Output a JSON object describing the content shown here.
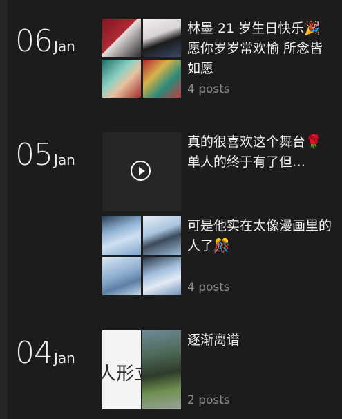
{
  "colors": {
    "background": "#1c1c1c",
    "text": "#f2f2f2",
    "muted": "#8c8c8c"
  },
  "days": [
    {
      "num": "06",
      "mon": "Jan"
    },
    {
      "num": "05",
      "mon": "Jan"
    },
    {
      "num": "04",
      "mon": "Jan"
    }
  ],
  "posts": [
    {
      "caption": "林墨 21 岁生日快乐🎉\n愿你岁岁常欢愉 所念皆如愿",
      "count": "4 posts",
      "thumb_type": "4-photo-grid"
    },
    {
      "caption": "真的很喜欢这个舞台🌹\n单人的终于有了但…",
      "count": "",
      "thumb_type": "video"
    },
    {
      "caption": "可是他实在太像漫画里的人了🎊",
      "count": "4 posts",
      "thumb_type": "4-photo-grid"
    },
    {
      "caption": "逐渐离谱",
      "count": "2 posts",
      "thumb_type": "2-photo-grid",
      "thumb_text": "人形立"
    }
  ]
}
